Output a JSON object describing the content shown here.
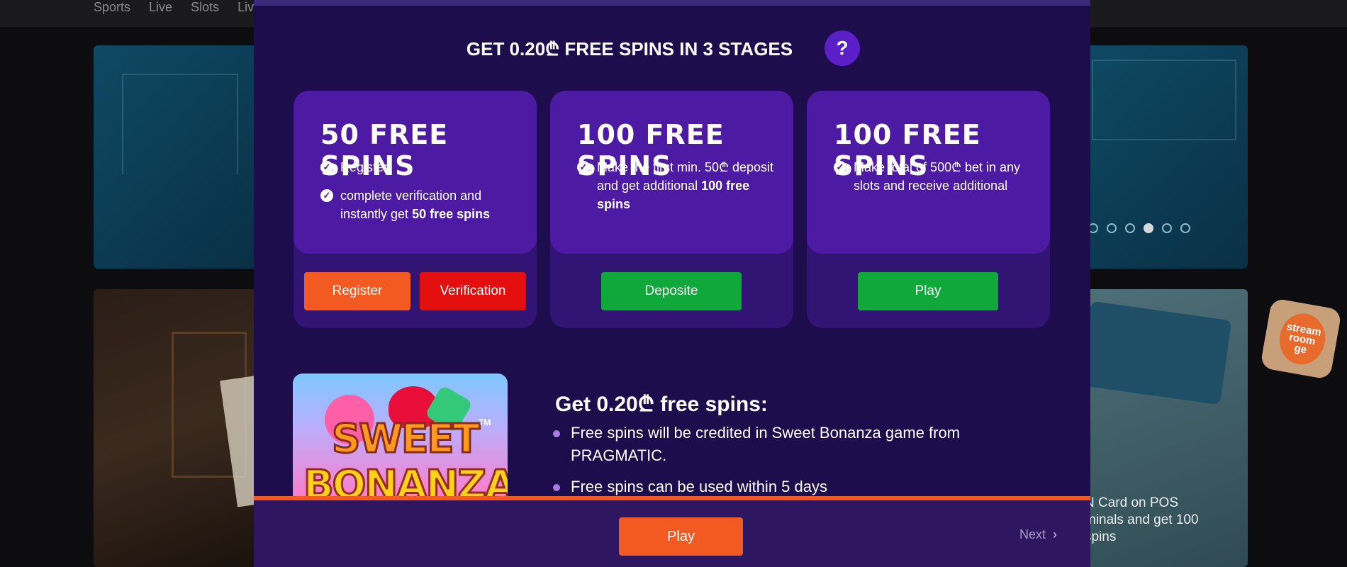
{
  "background": {
    "nav": [
      "Sports",
      "Live",
      "Slots",
      "Liv"
    ],
    "carousel_dots": 6,
    "carousel_active": 4,
    "promo_right_text": "N Card on POS\nminals and get 100\nspins",
    "stream_badge": "stream\nroom\nge"
  },
  "modal": {
    "title": "GET 0.20₾ FREE SPINS IN 3 STAGES",
    "help_label": "?",
    "stages": [
      {
        "heading": "50 FREE SPINS",
        "items": [
          {
            "text": "Register",
            "bold": ""
          },
          {
            "text": "complete verification and instantly get ",
            "bold": "50 free spins"
          }
        ],
        "buttons": [
          "Register",
          "Verification"
        ]
      },
      {
        "heading": "100 FREE SPINS",
        "items": [
          {
            "text": "Make the first min. 50₾ deposit and get additional ",
            "bold": "100 free spins"
          }
        ],
        "buttons": [
          "Deposite"
        ]
      },
      {
        "heading": "100 FREE SPINS",
        "items": [
          {
            "text": "Make total of 500₾ bet in any slots and receive additional",
            "bold": ""
          }
        ],
        "buttons": [
          "Play"
        ]
      }
    ],
    "game": {
      "line1": "SWEET",
      "line2": "BONANZA",
      "tm": "TM"
    },
    "info_title": "Get 0.20₾ free spins:",
    "info_items": [
      "Free spins will be credited in Sweet Bonanza game from PRAGMATIC.",
      "Free spins can be used within 5 days"
    ],
    "footer": {
      "play_label": "Play",
      "next_label": "Next",
      "next_icon": "chevron-right-icon"
    }
  },
  "colors": {
    "modal_bg": "#1d0d4d",
    "stage_top": "#4c1aa3",
    "stage_bottom": "#311473",
    "orange": "#f25a22",
    "red": "#e30e0e",
    "green": "#11a83b"
  }
}
